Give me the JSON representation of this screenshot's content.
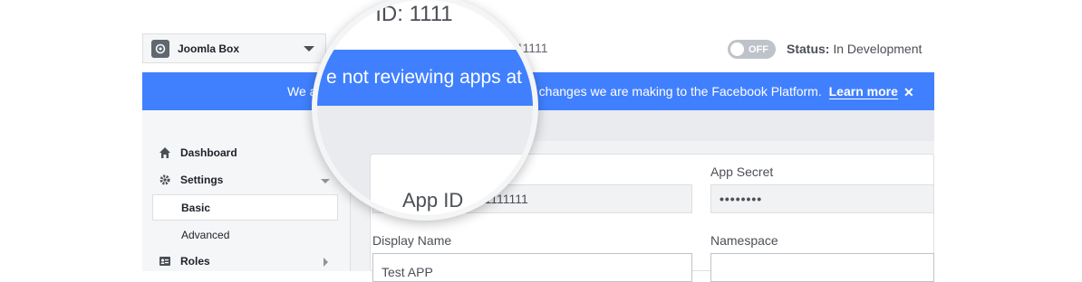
{
  "app_selector": {
    "name": "Joomla Box",
    "icon": "app-gear-icon"
  },
  "header": {
    "app_id_partial": "111111",
    "toggle_label": "OFF",
    "status_label": "Status:",
    "status_value": "In Development"
  },
  "banner": {
    "prefix": "We a",
    "text": "o changes we are making to the Facebook Platform.",
    "link": "Learn more",
    "close_icon": "close-icon",
    "color": "#4080ff"
  },
  "sidebar": {
    "items": [
      {
        "label": "Dashboard",
        "icon": "home-icon"
      },
      {
        "label": "Settings",
        "icon": "gear-icon"
      },
      {
        "label": "Roles",
        "icon": "id-card-icon"
      }
    ],
    "sub_items": [
      {
        "label": "Basic"
      },
      {
        "label": "Advanced"
      }
    ]
  },
  "form": {
    "app_id_value": "111111111",
    "app_secret_label": "App Secret",
    "app_secret_value": "••••••••",
    "display_name_label": "Display Name",
    "display_name_value": "Test APP",
    "namespace_label": "Namespace"
  },
  "magnifier": {
    "app_id_text": "P ID: 1111",
    "banner_text": "e not reviewing apps at",
    "field_label": "App ID"
  }
}
